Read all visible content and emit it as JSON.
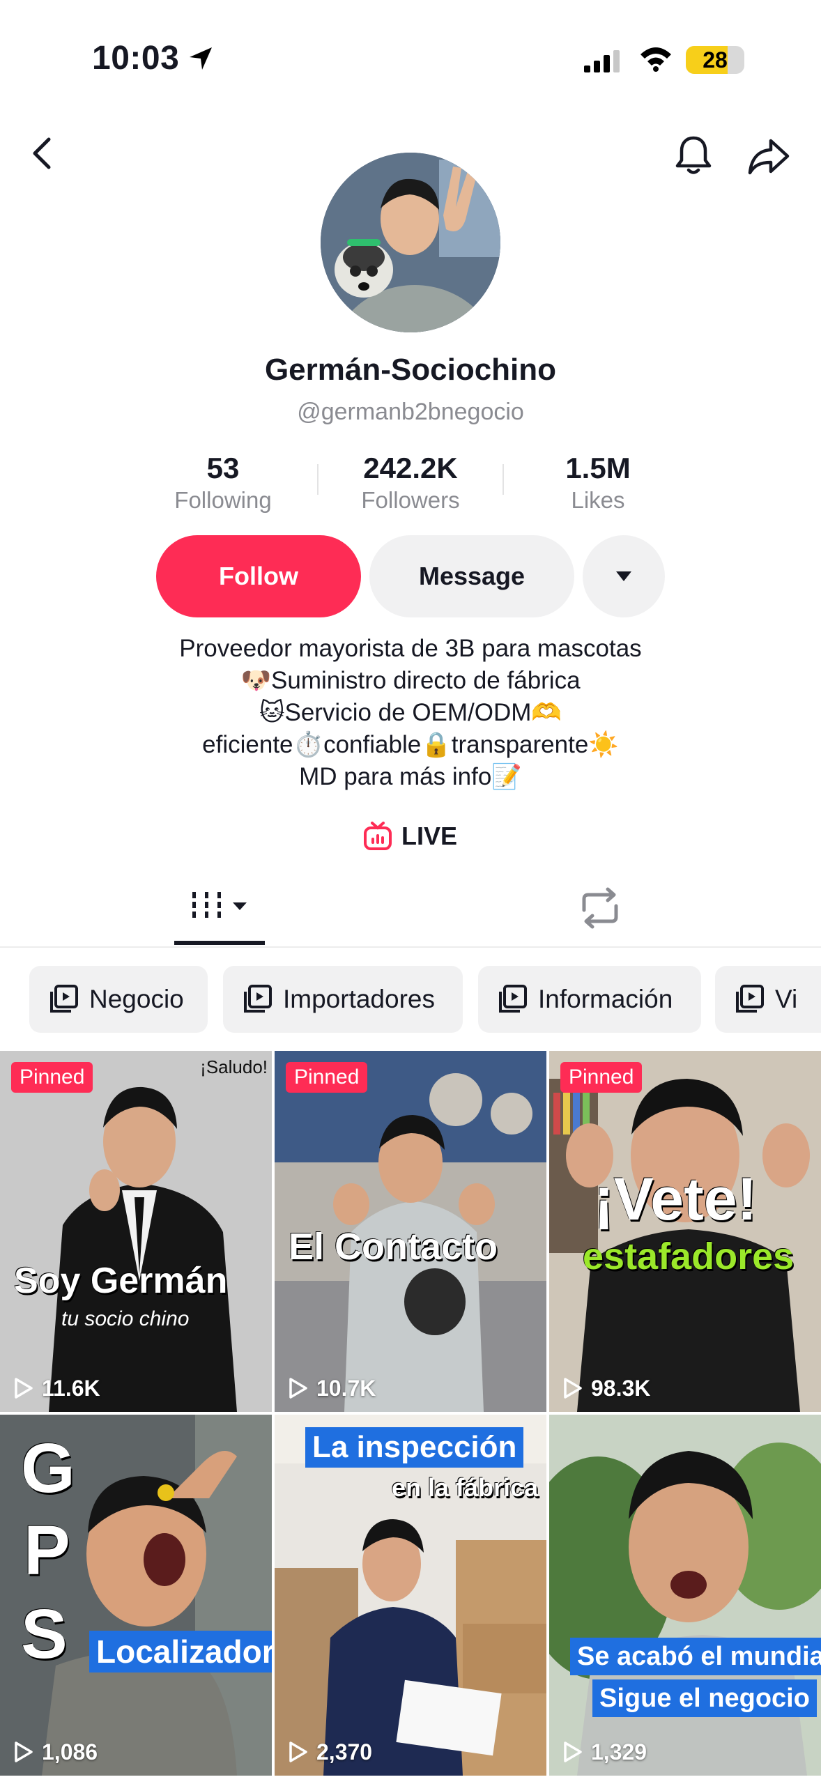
{
  "status_bar": {
    "time": "10:03",
    "battery": "28",
    "battery_level": 0.28
  },
  "profile": {
    "display_name": "Germán-Sociochino",
    "handle": "@germanb2bnegocio",
    "stats": [
      {
        "value": "53",
        "label": "Following"
      },
      {
        "value": "242.2K",
        "label": "Followers"
      },
      {
        "value": "1.5M",
        "label": "Likes"
      }
    ],
    "actions": {
      "follow": "Follow",
      "message": "Message"
    },
    "bio_lines": [
      "Proveedor mayorista de 3B para mascotas",
      "🐶Suministro directo de fábrica",
      "🐱Servicio de OEM/ODM🫶",
      "eficiente⏱️confiable🔒transparente☀️",
      "MD para más info📝"
    ],
    "live_label": "LIVE"
  },
  "playlists": [
    "Negocio",
    "Importadores",
    "Información",
    "Vi"
  ],
  "videos": [
    {
      "pinned": "Pinned",
      "views": "11.6K",
      "text_top": "¡Saludo!",
      "title": "Soy Germán",
      "subtitle": "tu socio chino"
    },
    {
      "pinned": "Pinned",
      "views": "10.7K",
      "title": "El Contacto"
    },
    {
      "pinned": "Pinned",
      "views": "98.3K",
      "title": "¡Vete!",
      "subtitle": "estafadores"
    },
    {
      "views": "1,086",
      "letters": [
        "G",
        "P",
        "S"
      ],
      "label": "Localizador"
    },
    {
      "views": "2,370",
      "label": "La inspección",
      "subtitle": "en la fábrica"
    },
    {
      "views": "1,329",
      "label": "Se acabó el mundial",
      "label2": "Sigue el negocio"
    }
  ],
  "colors": {
    "accent": "#fe2c55",
    "secondary_button": "#f1f1f2",
    "muted_text": "#8a8b91",
    "battery": "#f7cf1a",
    "green_text": "#9be82a",
    "label_blue": "#1f6fe0"
  }
}
